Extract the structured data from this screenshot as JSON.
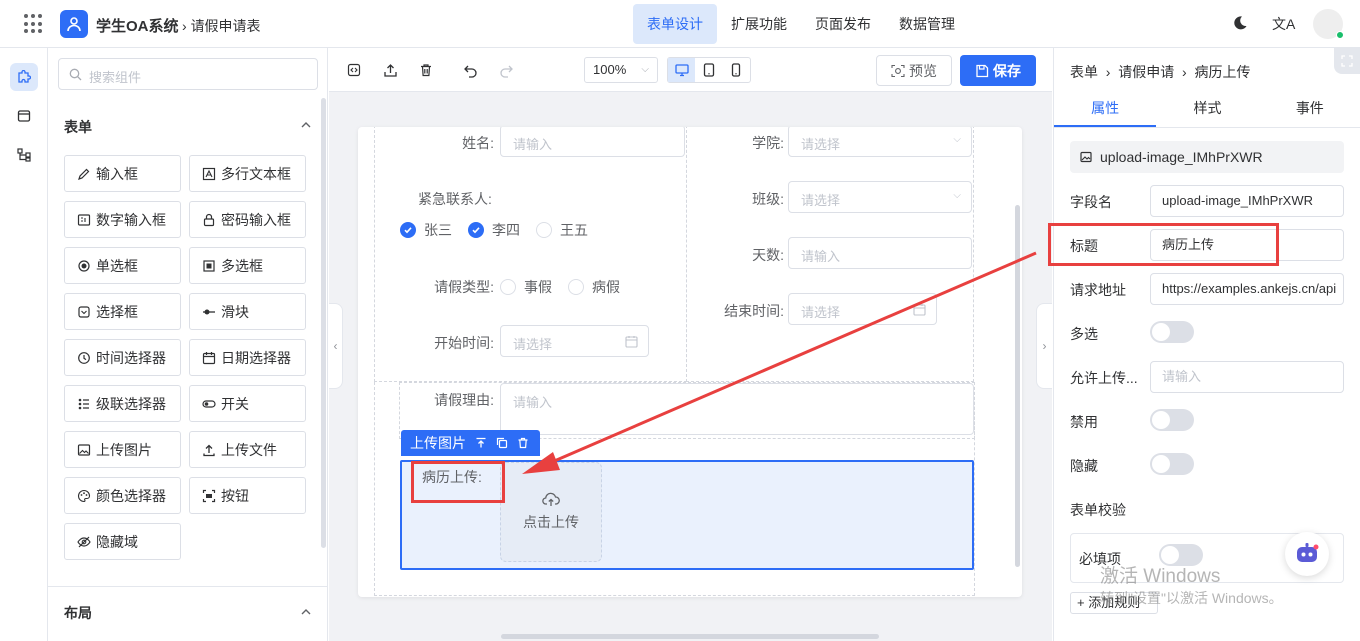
{
  "header": {
    "app_title": "学生OA系统",
    "breadcrumb": "请假申请表",
    "nav": [
      {
        "label": "表单设计",
        "active": true
      },
      {
        "label": "扩展功能",
        "active": false
      },
      {
        "label": "页面发布",
        "active": false
      },
      {
        "label": "数据管理",
        "active": false
      }
    ],
    "lang_icon_text": "文A"
  },
  "components": {
    "search_placeholder": "搜索组件",
    "form_section_title": "表单",
    "layout_section_title": "布局",
    "items": [
      {
        "label": "输入框",
        "icon": "pencil-icon"
      },
      {
        "label": "多行文本框",
        "icon": "textarea-icon"
      },
      {
        "label": "数字输入框",
        "icon": "number-icon"
      },
      {
        "label": "密码输入框",
        "icon": "lock-icon"
      },
      {
        "label": "单选框",
        "icon": "radio-icon"
      },
      {
        "label": "多选框",
        "icon": "checkbox-icon"
      },
      {
        "label": "选择框",
        "icon": "select-icon"
      },
      {
        "label": "滑块",
        "icon": "slider-icon"
      },
      {
        "label": "时间选择器",
        "icon": "clock-icon"
      },
      {
        "label": "日期选择器",
        "icon": "calendar-icon"
      },
      {
        "label": "级联选择器",
        "icon": "cascader-icon"
      },
      {
        "label": "开关",
        "icon": "switch-icon"
      },
      {
        "label": "上传图片",
        "icon": "image-icon"
      },
      {
        "label": "上传文件",
        "icon": "upload-icon"
      },
      {
        "label": "颜色选择器",
        "icon": "palette-icon"
      },
      {
        "label": "按钮",
        "icon": "button-icon"
      },
      {
        "label": "隐藏域",
        "icon": "eye-off-icon"
      }
    ]
  },
  "toolbar": {
    "zoom": "100%",
    "preview_label": "预览",
    "save_label": "保存"
  },
  "form": {
    "name_label": "姓名:",
    "name_placeholder": "请输入",
    "college_label": "学院:",
    "college_placeholder": "请选择",
    "contact_label": "紧急联系人:",
    "contacts": [
      {
        "label": "张三",
        "checked": true
      },
      {
        "label": "李四",
        "checked": true
      },
      {
        "label": "王五",
        "checked": false
      }
    ],
    "class_label": "班级:",
    "class_placeholder": "请选择",
    "days_label": "天数:",
    "days_placeholder": "请输入",
    "leave_type_label": "请假类型:",
    "leave_types": [
      "事假",
      "病假"
    ],
    "end_time_label": "结束时间:",
    "end_time_placeholder": "请选择",
    "start_time_label": "开始时间:",
    "start_time_placeholder": "请选择",
    "reason_label": "请假理由:",
    "reason_placeholder": "请输入",
    "selected_component_label": "上传图片",
    "upload_label": "病历上传:",
    "upload_button": "点击上传"
  },
  "props": {
    "breadcrumb": [
      "表单",
      "请假申请",
      "病历上传"
    ],
    "tabs": [
      {
        "label": "属性",
        "active": true
      },
      {
        "label": "样式",
        "active": false
      },
      {
        "label": "事件",
        "active": false
      }
    ],
    "component_id": "upload-image_IMhPrXWR",
    "field_name_label": "字段名",
    "field_name_value": "upload-image_IMhPrXWR",
    "title_label": "标题",
    "title_value": "病历上传",
    "url_label": "请求地址",
    "url_value": "https://examples.ankejs.cn/api",
    "multiple_label": "多选",
    "allow_label": "允许上传...",
    "allow_placeholder": "请输入",
    "disabled_label": "禁用",
    "hidden_label": "隐藏",
    "validation_label": "表单校验",
    "required_label": "必填项",
    "add_rule_label": "+ 添加规则"
  },
  "watermark": {
    "line1": "激活 Windows",
    "line2": "转到\"设置\"以激活 Windows。"
  },
  "colors": {
    "primary": "#2d6df6",
    "annotation": "#e8403f"
  }
}
